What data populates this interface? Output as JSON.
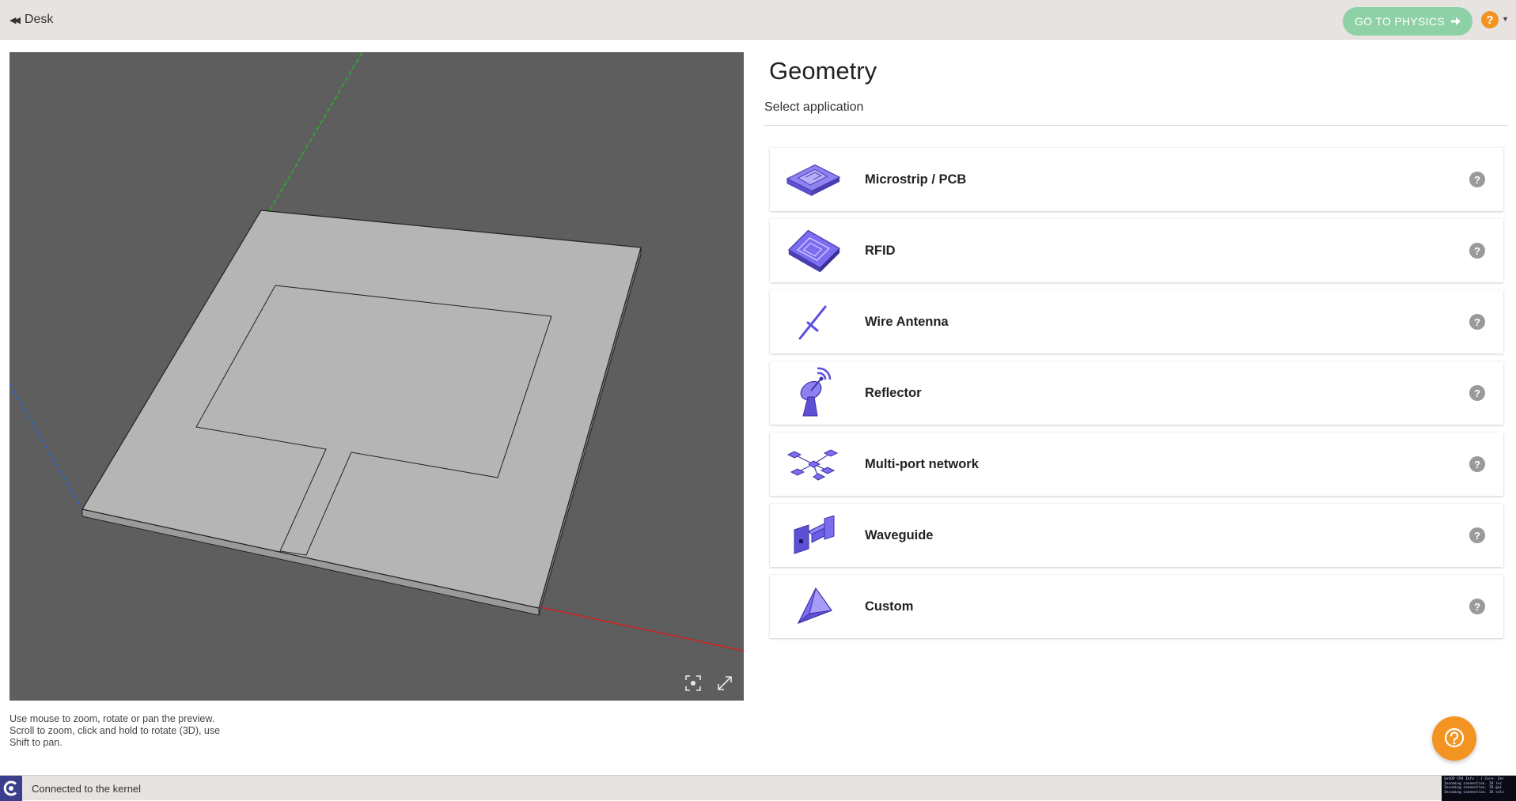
{
  "topbar": {
    "back_label": "Desk",
    "physics_button_label": "GO TO PHYSICS",
    "help_label": "?"
  },
  "viewport": {
    "hint_lines": [
      "Use mouse to zoom, rotate or pan the preview.",
      "Scroll to zoom, click and hold to rotate (3D), use",
      "Shift to pan."
    ],
    "colors": {
      "background": "#5e5e5e",
      "board": "#b5b5b5",
      "x_axis": "#d42020",
      "y_axis": "#28b428",
      "z_axis": "#2a6ad4"
    }
  },
  "panel": {
    "title": "Geometry",
    "subtitle": "Select application",
    "applications": [
      {
        "label": "Microstrip / PCB",
        "icon": "microstrip-pcb-icon"
      },
      {
        "label": "RFID",
        "icon": "rfid-chip-icon"
      },
      {
        "label": "Wire Antenna",
        "icon": "wire-antenna-icon"
      },
      {
        "label": "Reflector",
        "icon": "reflector-dish-icon"
      },
      {
        "label": "Multi-port network",
        "icon": "multiport-network-icon"
      },
      {
        "label": "Waveguide",
        "icon": "waveguide-icon"
      },
      {
        "label": "Custom",
        "icon": "custom-shape-icon"
      }
    ],
    "info_label": "?"
  },
  "statusbar": {
    "status": "Connected to the kernel",
    "console_lines": [
      "GetDP CPU Info : { Core: Zer",
      "Incoming connection. IO loc",
      "Incoming connection. IO gui",
      "Incoming connection. IO solv"
    ]
  },
  "colors": {
    "accent": "#8fd1a6",
    "help": "#f39422",
    "icon_purple": "#7b6cf0"
  }
}
